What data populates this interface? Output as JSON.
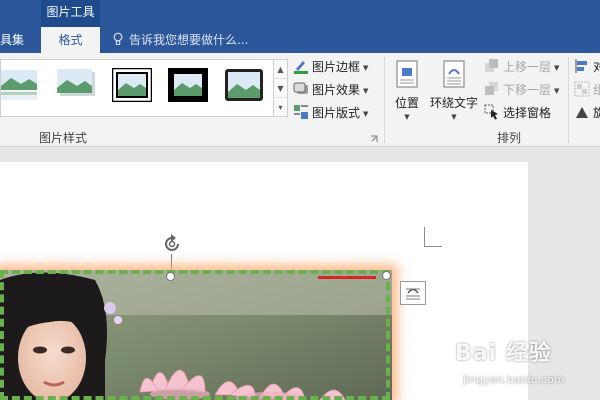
{
  "tabs": {
    "partial_left": "具集",
    "context_group": "图片工具",
    "active": "格式",
    "tell_me": "告诉我您想要做什么..."
  },
  "picture_styles": {
    "group_label": "图片样式",
    "border_label": "图片边框",
    "effects_label": "图片效果",
    "layout_label": "图片版式",
    "gallery": [
      "style-reflection",
      "style-soft-shadow",
      "style-double-frame",
      "style-black-thick-frame",
      "style-rounded-frame"
    ]
  },
  "arrange": {
    "group_label": "排列",
    "position_label": "位置",
    "wrap_text_label": "环绕文字",
    "bring_forward_label": "上移一层",
    "send_backward_label": "下移一层",
    "selection_pane_label": "选择窗格",
    "align_partial": "对",
    "group_partial": "组",
    "rotate_partial": "旋"
  },
  "watermark": {
    "main": "Bai 经验",
    "sub": "jingyan.baidu.com"
  },
  "colors": {
    "ribbon_blue": "#2b579a",
    "selection_dash": "#6ab04c",
    "picture_glow": "#ffaa6e"
  }
}
